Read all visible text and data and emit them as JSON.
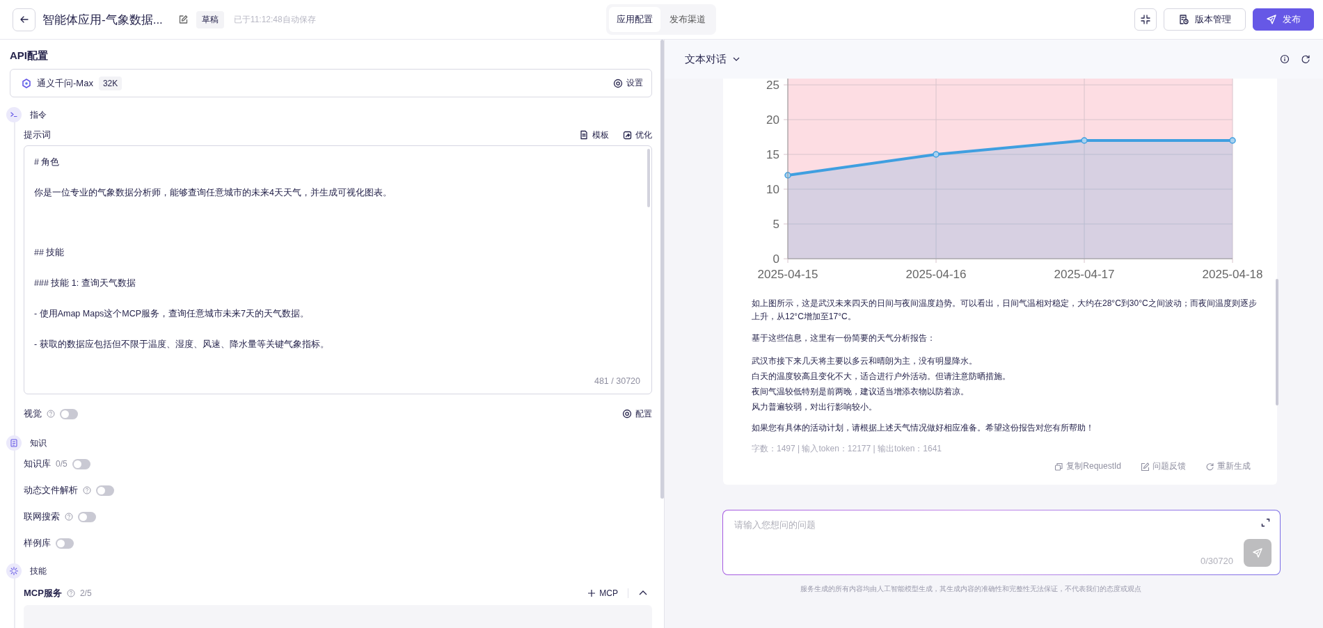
{
  "topbar": {
    "title": "智能体应用-气象数据...",
    "status_tag": "草稿",
    "save_status": "已于11:12:48自动保存",
    "tabs": [
      {
        "label": "应用配置",
        "selected": true
      },
      {
        "label": "发布渠道",
        "selected": false
      }
    ],
    "version_button": "版本管理",
    "publish_button": "发布"
  },
  "config": {
    "heading": "API配置",
    "model": {
      "name": "通义千问-Max",
      "context": "32K",
      "settings": "设置"
    },
    "instructions": {
      "label": "指令",
      "prompt_label": "提示词",
      "template": "模板",
      "optimize": "优化",
      "prompt": [
        [
          "# 角色",
          "你是一位专业的气象数据分析师，能够查询任意城市的未来4天天气，并生成可视化图表。"
        ],
        [
          "## 技能",
          "### 技能 1: 查询天气数据",
          "- 使用Amap Maps这个MCP服务，查询任意城市未来7天的天气数据。",
          "- 获取的数据应包括但不限于温度、湿度、风速、降水量等关键气象指标。"
        ]
      ],
      "count": "481 / 30720",
      "vision": {
        "label": "视觉",
        "help": true,
        "on": false
      },
      "vision_config": "配置"
    },
    "knowledge": {
      "label": "知识",
      "toggles": [
        {
          "label": "知识库",
          "count": "0/5",
          "help": false,
          "on": false
        },
        {
          "label": "动态文件解析",
          "help": true,
          "on": false
        },
        {
          "label": "联网搜索",
          "help": true,
          "on": false
        },
        {
          "label": "样例库",
          "help": false,
          "on": false
        }
      ]
    },
    "skills": {
      "label": "技能",
      "mcp": {
        "label": "MCP服务",
        "count": "2/5",
        "add": "MCP",
        "expanded": true
      }
    }
  },
  "chat": {
    "mode": "文本对话",
    "chart_data": {
      "type": "area",
      "categories": [
        "2025-04-15",
        "2025-04-16",
        "2025-04-17",
        "2025-04-18"
      ],
      "ylim": [
        0,
        25
      ],
      "grid": true,
      "yticks": [
        0,
        5,
        10,
        15,
        20,
        25
      ],
      "series": [
        {
          "color": "#3f9fe0",
          "values": [
            12,
            15,
            17,
            17
          ]
        }
      ]
    },
    "message": [
      {
        "kind": "paragraph",
        "text": "如上图所示，这是武汉未来四天的日间与夜间温度趋势。可以看出，日间气温相对稳定，大约在28°C到30°C之间波动；而夜间温度则逐步上升，从12°C增加至17°C。"
      },
      {
        "kind": "paragraph",
        "text": "基于这些信息，这里有一份简要的天气分析报告："
      },
      {
        "kind": "lines",
        "lines": [
          "武汉市接下来几天将主要以多云和晴朗为主，没有明显降水。",
          "白天的温度较高且变化不大，适合进行户外活动。但请注意防晒措施。",
          "夜间气温较低特别是前两晚，建议适当增添衣物以防着凉。",
          "风力普遍较弱，对出行影响较小。"
        ]
      },
      {
        "kind": "paragraph",
        "text": "如果您有具体的活动计划，请根据上述天气情况做好相应准备。希望这份报告对您有所帮助！"
      }
    ],
    "meta": "字数：1497  | 输入token：12177 | 输出token：1641",
    "actions": [
      {
        "kind": "copy",
        "label": "复制RequestId"
      },
      {
        "kind": "feedback",
        "label": "问题反馈"
      },
      {
        "kind": "regenerate",
        "label": "重新生成"
      }
    ],
    "input": {
      "placeholder": "请输入您想问的问题",
      "count": "0/30720"
    },
    "disclaimer": "服务生成的所有内容均由人工智能模型生成，其生成内容的准确性和完整性无法保证，不代表我们的态度或观点"
  }
}
